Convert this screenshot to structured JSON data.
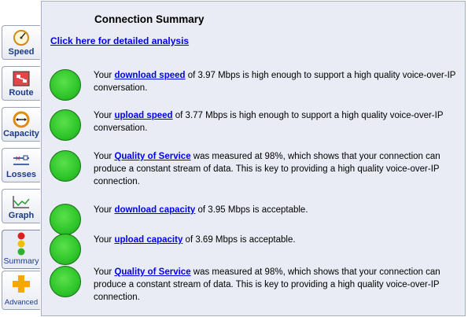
{
  "tabs": [
    {
      "label": "Speed",
      "icon": "speedometer-icon"
    },
    {
      "label": "Route",
      "icon": "route-map-icon"
    },
    {
      "label": "Capacity",
      "icon": "capacity-arrows-icon"
    },
    {
      "label": "Losses",
      "icon": "losses-icon"
    },
    {
      "label": "Graph",
      "icon": "line-graph-icon"
    },
    {
      "label": "Summary",
      "icon": "traffic-light-icon",
      "active": true
    },
    {
      "label": "Advanced",
      "icon": "plus-icon"
    }
  ],
  "panel": {
    "title": "Connection Summary",
    "detail_link": "Click here for detailed analysis"
  },
  "status_color": "#2ec52a",
  "results": [
    {
      "prefix": "Your ",
      "link": "download speed",
      "suffix": " of 3.97 Mbps is high enough to support a high quality voice-over-IP conversation.",
      "status": "green"
    },
    {
      "prefix": "Your ",
      "link": "upload speed",
      "suffix": " of 3.77 Mbps is high enough to support a high quality voice-over-IP conversation.",
      "status": "green"
    },
    {
      "prefix": "Your ",
      "link": "Quality of Service",
      "suffix": " was measured at 98%, which shows that your connection can produce a constant stream of data. This is key to providing a high quality voice-over-IP connection.",
      "status": "green"
    },
    {
      "prefix": "Your ",
      "link": "download capacity",
      "suffix": " of 3.95 Mbps is acceptable.",
      "status": "green"
    },
    {
      "prefix": "Your ",
      "link": "upload capacity",
      "suffix": " of 3.69 Mbps is acceptable.",
      "status": "green"
    },
    {
      "prefix": "Your ",
      "link": "Quality of Service",
      "suffix": " was measured at 98%, which shows that your connection can produce a constant stream of data. This is key to providing a high quality voice-over-IP connection.",
      "status": "green"
    }
  ]
}
